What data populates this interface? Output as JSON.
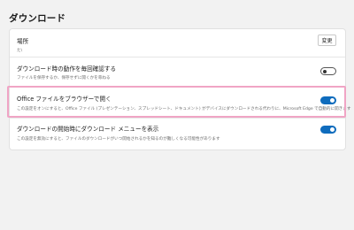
{
  "page": {
    "title": "ダウンロード"
  },
  "settings": {
    "location": {
      "title": "場所",
      "value": "た\\",
      "change_label": "変更"
    },
    "ask_each_time": {
      "title": "ダウンロード時の動作を毎回確認する",
      "description": "ファイルを保存するか、保存せずに開くかを尋ねる",
      "enabled": false
    },
    "office_in_browser": {
      "title": "Office ファイルをブラウザーで開く",
      "description": "この設定をオンにすると、Office ファイル (プレゼンテーション、スプレッドシート、ドキュメント) がデバイスにダウンロードされる代わりに、Microsoft Edge で自動的に開きます",
      "enabled": true
    },
    "show_menu_on_start": {
      "title": "ダウンロードの開始時にダウンロード メニューを表示",
      "description": "この設定を無効にすると、ファイルのダウンロードがいつ開始されるかを知るのが難しくなる可能性があります",
      "enabled": true
    }
  },
  "colors": {
    "toggle_on": "#0f6cbd",
    "highlight": "#f0a5c5"
  }
}
